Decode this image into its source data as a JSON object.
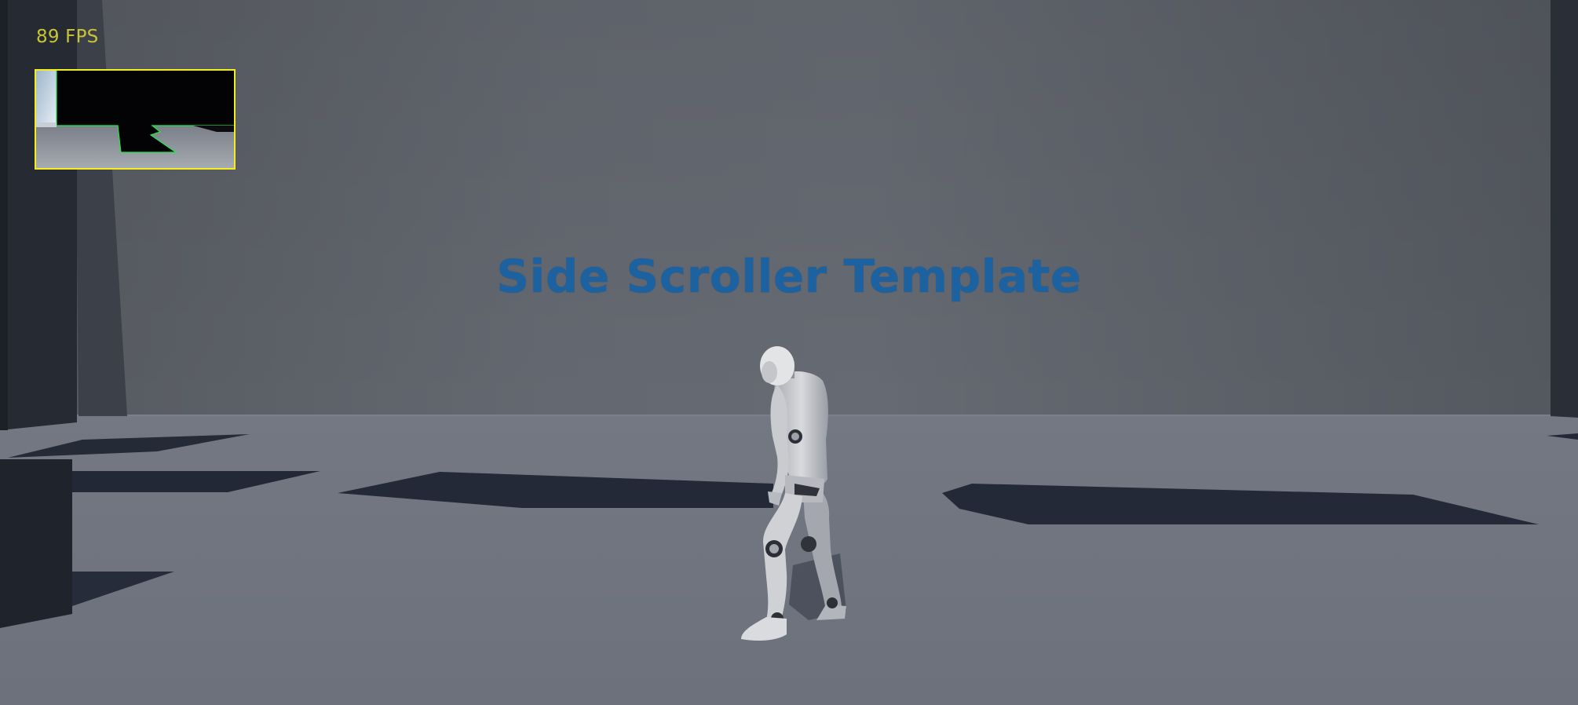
{
  "hud": {
    "fps_label": "89 FPS"
  },
  "level": {
    "wall_text": "Side Scroller Template"
  },
  "colors": {
    "fps_text": "#c9c336",
    "minimap_border": "#f2ec22",
    "wall_text": "#1d62a0",
    "minimap_outline": "#22e64a"
  }
}
